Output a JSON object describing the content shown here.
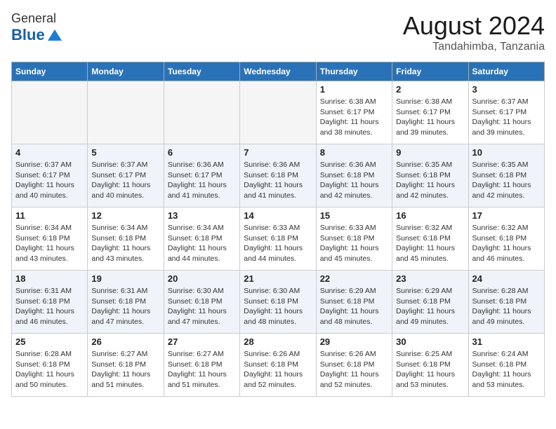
{
  "header": {
    "logo_general": "General",
    "logo_blue": "Blue",
    "month_year": "August 2024",
    "location": "Tandahimba, Tanzania"
  },
  "weekdays": [
    "Sunday",
    "Monday",
    "Tuesday",
    "Wednesday",
    "Thursday",
    "Friday",
    "Saturday"
  ],
  "weeks": [
    [
      {
        "day": "",
        "empty": true
      },
      {
        "day": "",
        "empty": true
      },
      {
        "day": "",
        "empty": true
      },
      {
        "day": "",
        "empty": true
      },
      {
        "day": "1",
        "sunrise": "6:38 AM",
        "sunset": "6:17 PM",
        "daylight": "11 hours and 38 minutes."
      },
      {
        "day": "2",
        "sunrise": "6:38 AM",
        "sunset": "6:17 PM",
        "daylight": "11 hours and 39 minutes."
      },
      {
        "day": "3",
        "sunrise": "6:37 AM",
        "sunset": "6:17 PM",
        "daylight": "11 hours and 39 minutes."
      }
    ],
    [
      {
        "day": "4",
        "sunrise": "6:37 AM",
        "sunset": "6:17 PM",
        "daylight": "11 hours and 40 minutes."
      },
      {
        "day": "5",
        "sunrise": "6:37 AM",
        "sunset": "6:17 PM",
        "daylight": "11 hours and 40 minutes."
      },
      {
        "day": "6",
        "sunrise": "6:36 AM",
        "sunset": "6:17 PM",
        "daylight": "11 hours and 41 minutes."
      },
      {
        "day": "7",
        "sunrise": "6:36 AM",
        "sunset": "6:18 PM",
        "daylight": "11 hours and 41 minutes."
      },
      {
        "day": "8",
        "sunrise": "6:36 AM",
        "sunset": "6:18 PM",
        "daylight": "11 hours and 42 minutes."
      },
      {
        "day": "9",
        "sunrise": "6:35 AM",
        "sunset": "6:18 PM",
        "daylight": "11 hours and 42 minutes."
      },
      {
        "day": "10",
        "sunrise": "6:35 AM",
        "sunset": "6:18 PM",
        "daylight": "11 hours and 42 minutes."
      }
    ],
    [
      {
        "day": "11",
        "sunrise": "6:34 AM",
        "sunset": "6:18 PM",
        "daylight": "11 hours and 43 minutes."
      },
      {
        "day": "12",
        "sunrise": "6:34 AM",
        "sunset": "6:18 PM",
        "daylight": "11 hours and 43 minutes."
      },
      {
        "day": "13",
        "sunrise": "6:34 AM",
        "sunset": "6:18 PM",
        "daylight": "11 hours and 44 minutes."
      },
      {
        "day": "14",
        "sunrise": "6:33 AM",
        "sunset": "6:18 PM",
        "daylight": "11 hours and 44 minutes."
      },
      {
        "day": "15",
        "sunrise": "6:33 AM",
        "sunset": "6:18 PM",
        "daylight": "11 hours and 45 minutes."
      },
      {
        "day": "16",
        "sunrise": "6:32 AM",
        "sunset": "6:18 PM",
        "daylight": "11 hours and 45 minutes."
      },
      {
        "day": "17",
        "sunrise": "6:32 AM",
        "sunset": "6:18 PM",
        "daylight": "11 hours and 46 minutes."
      }
    ],
    [
      {
        "day": "18",
        "sunrise": "6:31 AM",
        "sunset": "6:18 PM",
        "daylight": "11 hours and 46 minutes."
      },
      {
        "day": "19",
        "sunrise": "6:31 AM",
        "sunset": "6:18 PM",
        "daylight": "11 hours and 47 minutes."
      },
      {
        "day": "20",
        "sunrise": "6:30 AM",
        "sunset": "6:18 PM",
        "daylight": "11 hours and 47 minutes."
      },
      {
        "day": "21",
        "sunrise": "6:30 AM",
        "sunset": "6:18 PM",
        "daylight": "11 hours and 48 minutes."
      },
      {
        "day": "22",
        "sunrise": "6:29 AM",
        "sunset": "6:18 PM",
        "daylight": "11 hours and 48 minutes."
      },
      {
        "day": "23",
        "sunrise": "6:29 AM",
        "sunset": "6:18 PM",
        "daylight": "11 hours and 49 minutes."
      },
      {
        "day": "24",
        "sunrise": "6:28 AM",
        "sunset": "6:18 PM",
        "daylight": "11 hours and 49 minutes."
      }
    ],
    [
      {
        "day": "25",
        "sunrise": "6:28 AM",
        "sunset": "6:18 PM",
        "daylight": "11 hours and 50 minutes."
      },
      {
        "day": "26",
        "sunrise": "6:27 AM",
        "sunset": "6:18 PM",
        "daylight": "11 hours and 51 minutes."
      },
      {
        "day": "27",
        "sunrise": "6:27 AM",
        "sunset": "6:18 PM",
        "daylight": "11 hours and 51 minutes."
      },
      {
        "day": "28",
        "sunrise": "6:26 AM",
        "sunset": "6:18 PM",
        "daylight": "11 hours and 52 minutes."
      },
      {
        "day": "29",
        "sunrise": "6:26 AM",
        "sunset": "6:18 PM",
        "daylight": "11 hours and 52 minutes."
      },
      {
        "day": "30",
        "sunrise": "6:25 AM",
        "sunset": "6:18 PM",
        "daylight": "11 hours and 53 minutes."
      },
      {
        "day": "31",
        "sunrise": "6:24 AM",
        "sunset": "6:18 PM",
        "daylight": "11 hours and 53 minutes."
      }
    ]
  ]
}
